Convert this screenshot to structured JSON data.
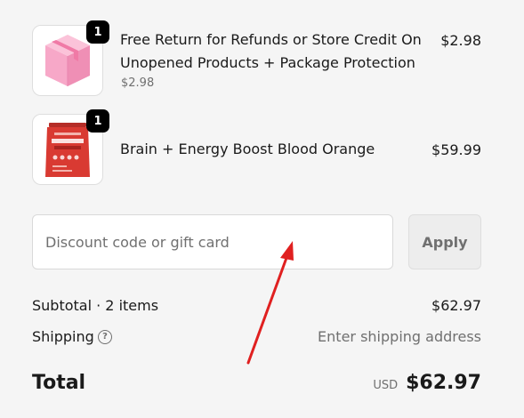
{
  "cart": {
    "items": [
      {
        "quantity": "1",
        "title": "Free Return for Refunds or Store Credit On Unopened Products + Package Protection",
        "subtitle": "$2.98",
        "price": "$2.98",
        "image": "pink-box-image"
      },
      {
        "quantity": "1",
        "title": "Brain + Energy Boost Blood Orange",
        "price": "$59.99",
        "image": "red-supplement-pouch-image"
      }
    ]
  },
  "discount": {
    "placeholder": "Discount code or gift card",
    "value": "",
    "apply_label": "Apply"
  },
  "summary": {
    "subtotal_label": "Subtotal · 2 items",
    "subtotal_value": "$62.97",
    "shipping_label": "Shipping",
    "shipping_help_icon": "question-circle-icon",
    "shipping_value": "Enter shipping address",
    "total_label": "Total",
    "total_currency": "USD",
    "total_value": "$62.97"
  },
  "colors": {
    "background": "#f5f5f5",
    "badge": "#000000",
    "annotation_arrow": "#e02020",
    "muted_text": "#707070",
    "box_pink": "#f7a8c8",
    "pouch_red": "#d93a32"
  }
}
